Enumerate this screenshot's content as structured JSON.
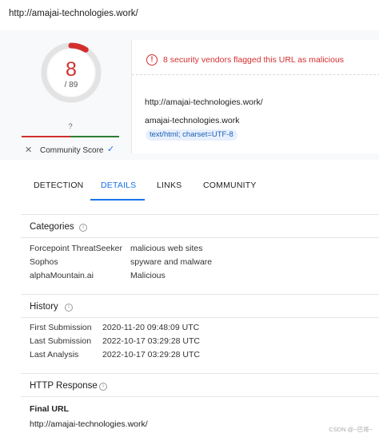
{
  "topbar": {
    "url": "http://amajai-technologies.work/"
  },
  "score": {
    "detections": "8",
    "total": "/ 89",
    "detected_fraction": 0.0899,
    "question_mark": "?",
    "community_label": "Community Score",
    "reject_icon": "close-icon",
    "accept_icon": "check-icon"
  },
  "alert": {
    "text": "8 security vendors flagged this URL as malicious",
    "icon": "alert-circle-icon"
  },
  "info": {
    "url": "http://amajai-technologies.work/",
    "host": "amajai-technologies.work",
    "content_type": "text/html; charset=UTF-8"
  },
  "tabs": [
    "DETECTION",
    "DETAILS",
    "LINKS",
    "COMMUNITY"
  ],
  "active_tab": "DETAILS",
  "categories": {
    "title": "Categories",
    "rows": [
      {
        "vendor": "Forcepoint ThreatSeeker",
        "category": "malicious web sites"
      },
      {
        "vendor": "Sophos",
        "category": "spyware and malware"
      },
      {
        "vendor": "alphaMountain.ai",
        "category": "Malicious"
      }
    ]
  },
  "history": {
    "title": "History",
    "rows": [
      {
        "label": "First Submission",
        "value": "2020-11-20 09:48:09 UTC"
      },
      {
        "label": "Last Submission",
        "value": "2022-10-17 03:29:28 UTC"
      },
      {
        "label": "Last Analysis",
        "value": "2022-10-17 03:29:28 UTC"
      }
    ]
  },
  "http": {
    "title": "HTTP Response",
    "final_url_label": "Final URL",
    "final_url": "http://amajai-technologies.work/"
  },
  "watermark": "CSDN @~巴哥~",
  "colors": {
    "malicious": "#d32f2f",
    "accent": "#1a73e8",
    "harmless": "#2e7d32"
  }
}
